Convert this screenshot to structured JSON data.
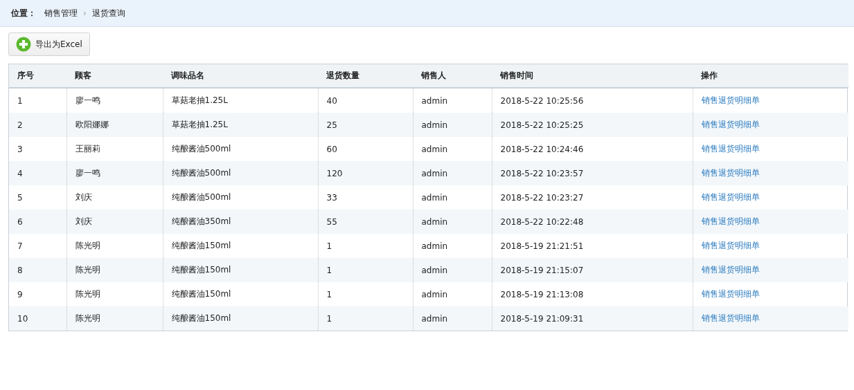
{
  "breadcrumb": {
    "label": "位置：",
    "items": [
      {
        "text": "销售管理",
        "kind": "link"
      },
      {
        "text": "›",
        "kind": "separator"
      },
      {
        "text": "退货查询",
        "kind": "current"
      }
    ]
  },
  "toolbar": {
    "export_button": "导出为Excel"
  },
  "table": {
    "columns": [
      "序号",
      "顾客",
      "调味品名",
      "退货数量",
      "销售人",
      "销售时间",
      "操作"
    ],
    "rows": [
      {
        "cells": [
          "1",
          "廖一鸣",
          "草菇老抽1.25L",
          "40",
          "admin",
          "2018-5-22 10:25:56"
        ],
        "action": "销售退货明细单"
      },
      {
        "cells": [
          "2",
          "欧阳娜娜",
          "草菇老抽1.25L",
          "25",
          "admin",
          "2018-5-22 10:25:25"
        ],
        "action": "销售退货明细单"
      },
      {
        "cells": [
          "3",
          "王丽莉",
          "纯酿酱油500ml",
          "60",
          "admin",
          "2018-5-22 10:24:46"
        ],
        "action": "销售退货明细单"
      },
      {
        "cells": [
          "4",
          "廖一鸣",
          "纯酿酱油500ml",
          "120",
          "admin",
          "2018-5-22 10:23:57"
        ],
        "action": "销售退货明细单"
      },
      {
        "cells": [
          "5",
          "刘庆",
          "纯酿酱油500ml",
          "33",
          "admin",
          "2018-5-22 10:23:27"
        ],
        "action": "销售退货明细单"
      },
      {
        "cells": [
          "6",
          "刘庆",
          "纯酿酱油350ml",
          "55",
          "admin",
          "2018-5-22 10:22:48"
        ],
        "action": "销售退货明细单"
      },
      {
        "cells": [
          "7",
          "陈光明",
          "纯酿酱油150ml",
          "1",
          "admin",
          "2018-5-19 21:21:51"
        ],
        "action": "销售退货明细单"
      },
      {
        "cells": [
          "8",
          "陈光明",
          "纯酿酱油150ml",
          "1",
          "admin",
          "2018-5-19 21:15:07"
        ],
        "action": "销售退货明细单"
      },
      {
        "cells": [
          "9",
          "陈光明",
          "纯酿酱油150ml",
          "1",
          "admin",
          "2018-5-19 21:13:08"
        ],
        "action": "销售退货明细单"
      },
      {
        "cells": [
          "10",
          "陈光明",
          "纯酿酱油150ml",
          "1",
          "admin",
          "2018-5-19 21:09:31"
        ],
        "action": "销售退货明细单"
      }
    ]
  }
}
